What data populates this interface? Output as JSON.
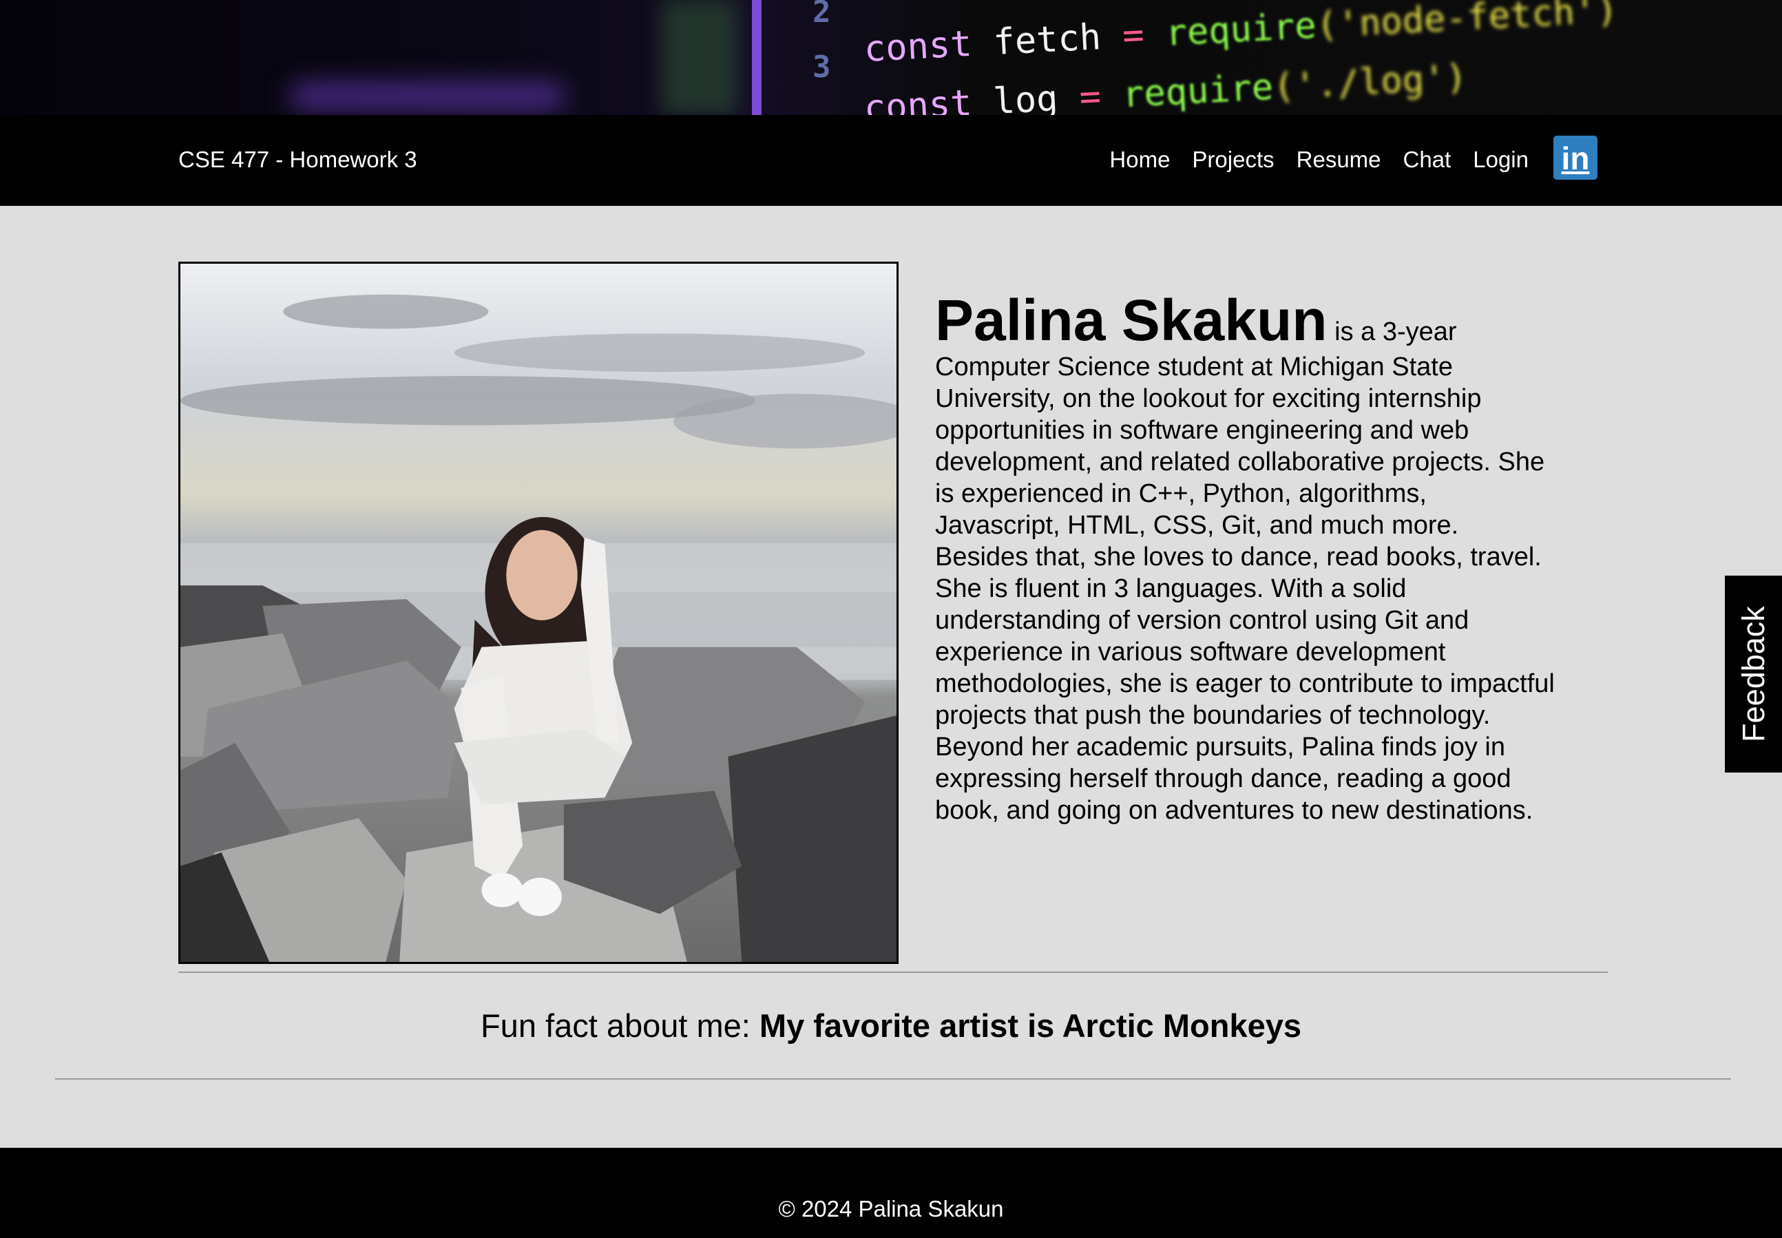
{
  "banner": {
    "line_numbers": [
      "2",
      "3"
    ],
    "code_lines": [
      {
        "keyword": "const",
        "identifier": "fetch",
        "operator": "=",
        "call": "require",
        "arg": "('node-fetch')"
      },
      {
        "keyword": "const",
        "identifier": "log",
        "operator": "=",
        "call": "require",
        "arg": "('./log')"
      }
    ]
  },
  "navbar": {
    "brand": "CSE 477 - Homework 3",
    "links": [
      "Home",
      "Projects",
      "Resume",
      "Chat",
      "Login"
    ],
    "linkedin_label": "in",
    "linkedin_color": "#2e7fc0"
  },
  "profile": {
    "name": "Palina Skakun",
    "intro": " is a 3-year Computer Science student at Michigan State University, on the lookout for exciting internship opportunities in software engineering and web development, and related collaborative projects. She is experienced in C++, Python, algorithms, Javascript, HTML, CSS, Git, and much more. Besides that, she loves to dance, read books, travel. She is fluent in 3 languages. With a solid understanding of version control using Git and experience in various software development methodologies, she is eager to contribute to impactful projects that push the boundaries of technology. Beyond her academic pursuits, Palina finds joy in expressing herself through dance, reading a good book, and going on adventures to new destinations."
  },
  "funfact": {
    "label": "Fun fact about me: ",
    "value": "My favorite artist is Arctic Monkeys"
  },
  "feedback": {
    "label": "Feedback"
  },
  "footer": {
    "copyright": "© 2024 Palina Skakun"
  }
}
